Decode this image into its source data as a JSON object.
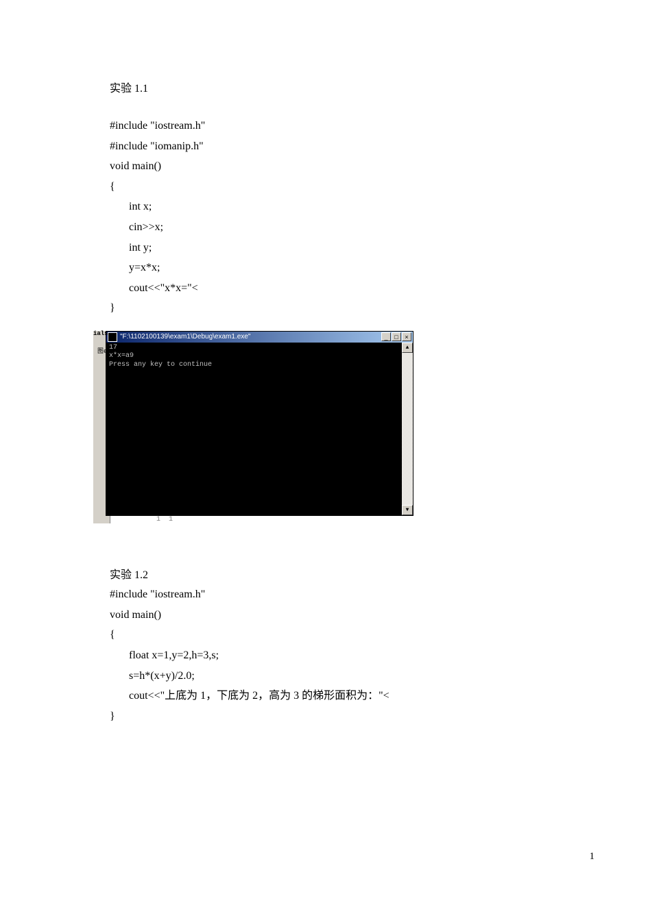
{
  "section1": {
    "title": "实验 1.1",
    "code": [
      "#include \"iostream.h\"",
      "#include \"iomanip.h\"",
      "void main()",
      "{",
      "int x;",
      "cin>>x;",
      "int y;",
      "y=x*x;",
      "cout<<\"x*x=\"<",
      "}"
    ]
  },
  "console": {
    "tab_label": "ials",
    "gutter_text": "图e:",
    "title_icon": "terminal-icon",
    "title": "\"F:\\1102100139\\exam1\\Debug\\exam1.exe\"",
    "min_btn": "_",
    "max_btn": "□",
    "close_btn": "×",
    "output_lines": [
      "17",
      "x*x=a9",
      "Press any key to continue"
    ],
    "scroll_up": "▲",
    "scroll_down": "▼",
    "bottom_mark": "1 1"
  },
  "section2": {
    "title": "实验 1.2",
    "code": [
      "#include \"iostream.h\"",
      "void main()",
      "{",
      "float x=1,y=2,h=3,s;",
      "s=h*(x+y)/2.0;",
      "cout<<\"上底为 1，下底为 2，高为 3 的梯形面积为：\"<",
      "}"
    ]
  },
  "page_number": "1"
}
